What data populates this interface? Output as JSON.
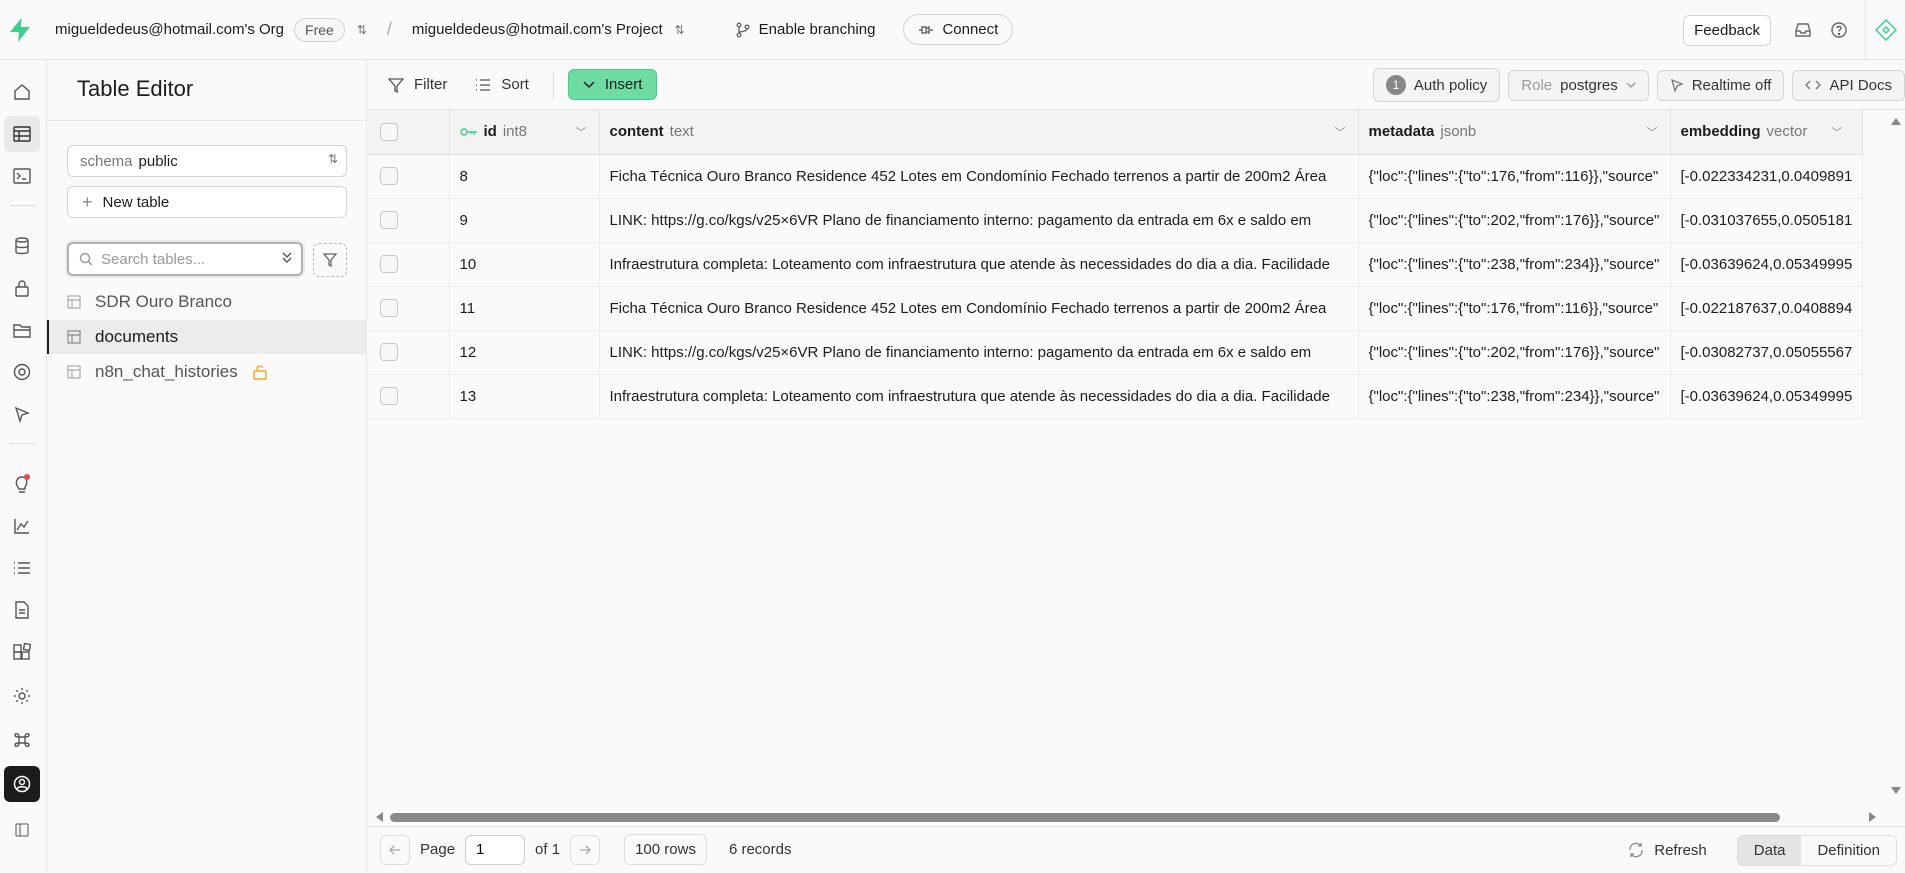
{
  "topbar": {
    "org": "migueldedeus@hotmail.com's Org",
    "plan_badge": "Free",
    "separator": "/",
    "project": "migueldedeus@hotmail.com's Project",
    "branching_label": "Enable branching",
    "connect_label": "Connect",
    "feedback_label": "Feedback"
  },
  "sidebar": {
    "title": "Table Editor",
    "schema_label": "schema",
    "schema_value": "public",
    "new_table_label": "New table",
    "search_placeholder": "Search tables...",
    "tables": [
      {
        "name": "SDR Ouro Branco",
        "active": false
      },
      {
        "name": "documents",
        "active": true
      },
      {
        "name": "n8n_chat_histories",
        "active": false,
        "unlocked_icon": true
      }
    ]
  },
  "toolbar": {
    "filter_label": "Filter",
    "sort_label": "Sort",
    "insert_label": "Insert",
    "auth_policy_count": "1",
    "auth_policy_label": "Auth policy",
    "role_label": "Role",
    "role_value": "postgres",
    "realtime_label": "Realtime off",
    "api_docs_label": "API Docs"
  },
  "grid": {
    "columns": [
      {
        "name": "id",
        "type": "int8",
        "key": true
      },
      {
        "name": "content",
        "type": "text"
      },
      {
        "name": "metadata",
        "type": "jsonb"
      },
      {
        "name": "embedding",
        "type": "vector"
      }
    ],
    "rows": [
      {
        "id": "8",
        "content": "Ficha Técnica Ouro Branco Residence 452 Lotes em Condomínio Fechado terrenos a partir de 200m2 Área",
        "metadata": "{\"loc\":{\"lines\":{\"to\":176,\"from\":116}},\"source\"",
        "embedding": "[-0.022334231,0.0409891"
      },
      {
        "id": "9",
        "content": "LINK: https://g.co/kgs/v25×6VR Plano de financiamento interno: pagamento da entrada em 6x e saldo em",
        "metadata": "{\"loc\":{\"lines\":{\"to\":202,\"from\":176}},\"source\"",
        "embedding": "[-0.031037655,0.0505181"
      },
      {
        "id": "10",
        "content": "Infraestrutura completa: Loteamento com infraestrutura que atende às necessidades do dia a dia. Facilidade",
        "metadata": "{\"loc\":{\"lines\":{\"to\":238,\"from\":234}},\"source\"",
        "embedding": "[-0.03639624,0.05349995"
      },
      {
        "id": "11",
        "content": "Ficha Técnica Ouro Branco Residence 452 Lotes em Condomínio Fechado terrenos a partir de 200m2 Área",
        "metadata": "{\"loc\":{\"lines\":{\"to\":176,\"from\":116}},\"source\"",
        "embedding": "[-0.022187637,0.0408894"
      },
      {
        "id": "12",
        "content": "LINK: https://g.co/kgs/v25×6VR Plano de financiamento interno: pagamento da entrada em 6x e saldo em",
        "metadata": "{\"loc\":{\"lines\":{\"to\":202,\"from\":176}},\"source\"",
        "embedding": "[-0.03082737,0.05055567"
      },
      {
        "id": "13",
        "content": "Infraestrutura completa: Loteamento com infraestrutura que atende às necessidades do dia a dia. Facilidade",
        "metadata": "{\"loc\":{\"lines\":{\"to\":238,\"from\":234}},\"source\"",
        "embedding": "[-0.03639624,0.05349995"
      }
    ]
  },
  "footer": {
    "page_label": "Page",
    "page_value": "1",
    "of_label": "of 1",
    "rows_label": "100 rows",
    "records_label": "6 records",
    "refresh_label": "Refresh",
    "data_tab": "Data",
    "definition_tab": "Definition"
  },
  "colors": {
    "brand": "#3ecf8e",
    "insert_bg": "#6ddba2",
    "lock_icon": "#f5a623",
    "notification_dot": "#e5484d"
  }
}
